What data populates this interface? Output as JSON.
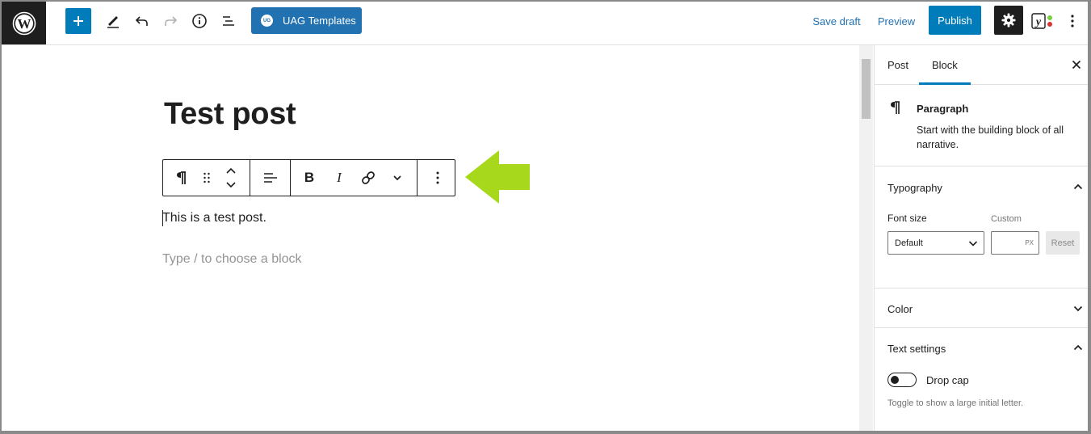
{
  "toolbar": {
    "logo_icon": "wordpress-logo-icon",
    "add_block_icon": "plus-icon",
    "tools_icon": "pencil-icon",
    "undo_icon": "undo-icon",
    "redo_icon": "redo-icon",
    "details_icon": "info-icon",
    "outline_icon": "list-view-icon",
    "uag_badge": "UG",
    "uag_label": "UAG Templates",
    "save_draft": "Save draft",
    "preview": "Preview",
    "publish": "Publish",
    "settings_icon": "gear-icon",
    "yoast_icon": "yoast-icon",
    "more_icon": "more-vertical-icon"
  },
  "editor": {
    "title": "Test post",
    "paragraph": "This is a test post.",
    "placeholder": "Type / to choose a block",
    "block_toolbar": [
      "pilcrow-icon",
      "drag-handle-icon",
      "move-up-down-icon",
      "align-icon",
      "bold-icon",
      "italic-icon",
      "link-icon",
      "chevron-down-icon",
      "more-vertical-icon"
    ],
    "annotation_arrow_color": "#a8d81c"
  },
  "sidebar": {
    "tabs": [
      {
        "label": "Post"
      },
      {
        "label": "Block",
        "active": true
      }
    ],
    "block_card": {
      "title": "Paragraph",
      "description_line1": "Start with the building block of all",
      "description_line2": "narrative."
    },
    "typography": {
      "title": "Typography",
      "font_size_label": "Font size",
      "custom_label": "Custom",
      "select_value": "Default",
      "unit": "PX",
      "reset": "Reset"
    },
    "color": {
      "title": "Color"
    },
    "text_settings": {
      "title": "Text settings",
      "drop_cap": "Drop cap",
      "help": "Toggle to show a large initial letter."
    }
  },
  "colors": {
    "accent": "#007cba",
    "uag_button": "#2271b1",
    "link": "#2271b1",
    "dark": "#1e1e1e"
  }
}
